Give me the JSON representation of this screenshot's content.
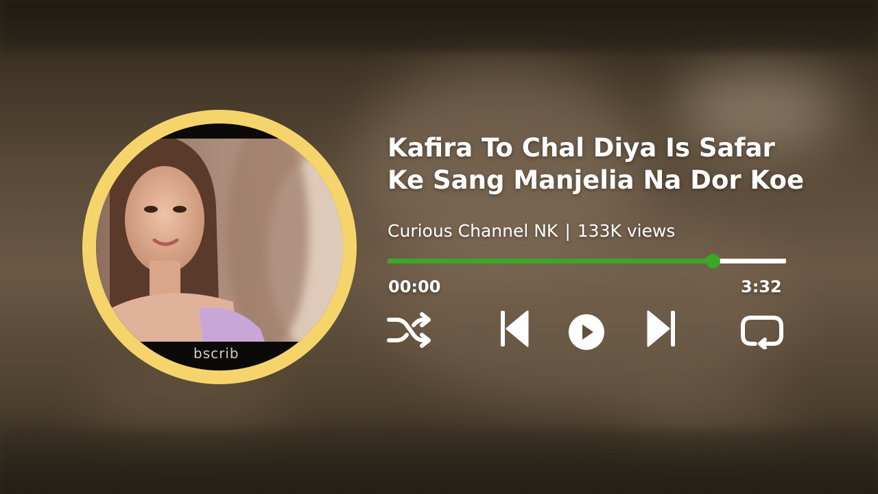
{
  "song": {
    "title_line1": "Kafira To Chal Diya Is Safar",
    "title_line2": "Ke Sang Manjelia Na Dor Koe",
    "channel": "Curious Channel NK",
    "separator": "|",
    "views": "133K views"
  },
  "album_art": {
    "overlay_text": "bscrib"
  },
  "player": {
    "progress": 0.815,
    "current_time": "00:00",
    "total_time": "3:32"
  },
  "controls": {
    "shuffle_icon": "shuffle-icon",
    "previous_icon": "skip-previous-icon",
    "play_icon": "play-icon",
    "next_icon": "skip-next-icon",
    "repeat_icon": "repeat-icon"
  },
  "colors": {
    "ring": "#f5d46c",
    "progress_fill": "#3aa824",
    "progress_track": "#ffffff",
    "text": "#ffffff"
  }
}
